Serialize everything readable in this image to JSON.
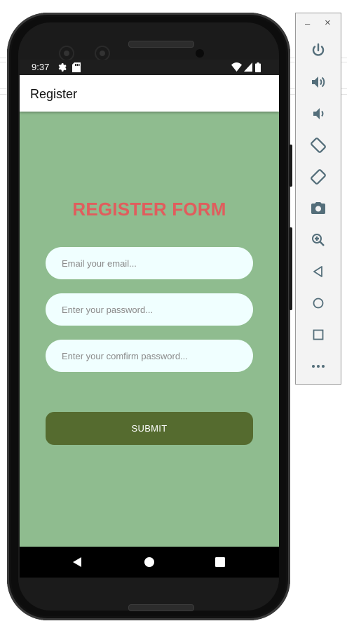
{
  "status_bar": {
    "time": "9:37"
  },
  "app_bar": {
    "title": "Register"
  },
  "form": {
    "heading": "REGISTER FORM",
    "email_placeholder": "Email your email...",
    "password_placeholder": "Enter your password...",
    "confirm_placeholder": "Enter your comfirm password...",
    "submit_label": "SUBMIT"
  },
  "colors": {
    "background": "#8fbc8f",
    "heading": "#e05d5d",
    "field_fill": "#f0ffff",
    "submit_fill": "#556b2f"
  },
  "emulator_toolbar": {
    "minimize_label": "–",
    "close_label": "×",
    "buttons": [
      "power-icon",
      "volume-up-icon",
      "volume-down-icon",
      "rotate-left-icon",
      "rotate-right-icon",
      "camera-icon",
      "zoom-icon",
      "back-icon",
      "home-icon",
      "overview-icon",
      "more-icon"
    ]
  },
  "nav_bar": {
    "buttons": [
      "back-icon",
      "home-icon",
      "recents-icon"
    ]
  }
}
